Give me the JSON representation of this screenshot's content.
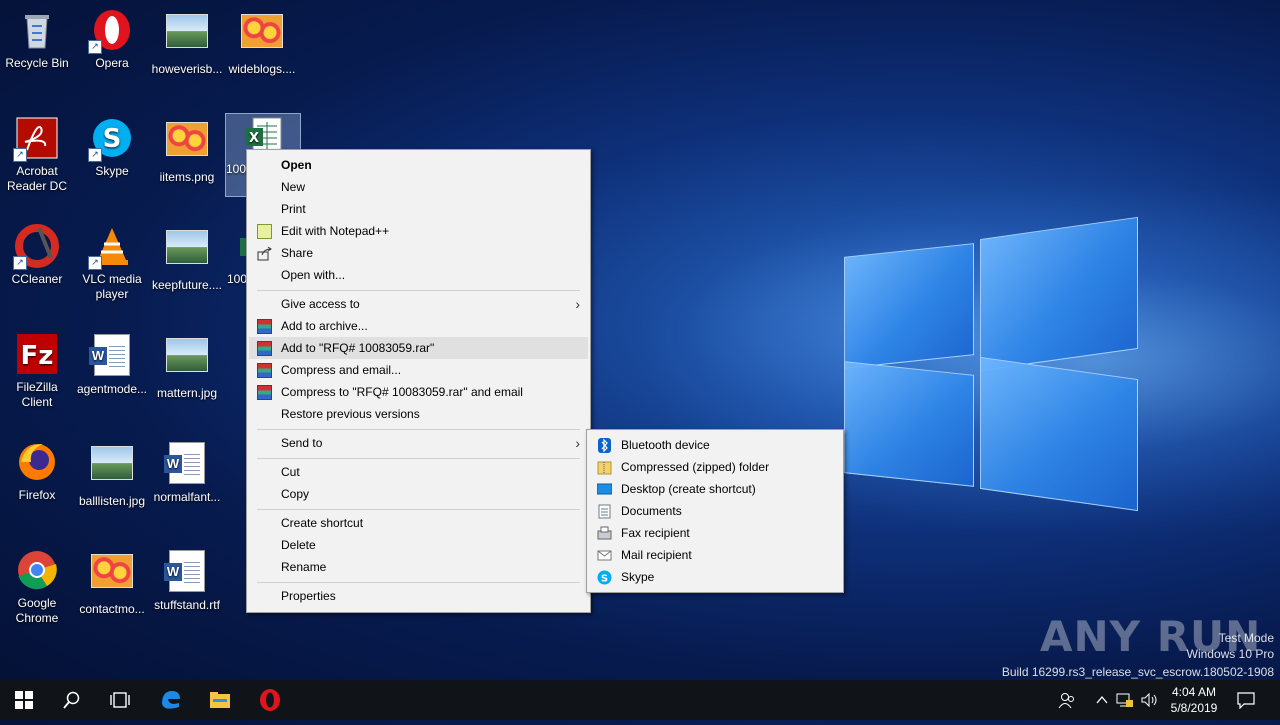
{
  "desktop": {
    "icons": [
      {
        "label": "Recycle Bin"
      },
      {
        "label": "Opera"
      },
      {
        "label": "howeverisb..."
      },
      {
        "label": "wideblogs...."
      },
      {
        "label": "Acrobat Reader DC"
      },
      {
        "label": "Skype"
      },
      {
        "label": "iitems.png"
      },
      {
        "label": "100"
      },
      {
        "label": "CCleaner"
      },
      {
        "label": "VLC media player"
      },
      {
        "label": "keepfuture...."
      },
      {
        "label": "100"
      },
      {
        "label": "FileZilla Client"
      },
      {
        "label": "agentmode..."
      },
      {
        "label": "mattern.jpg"
      },
      {
        "label": "Firefox"
      },
      {
        "label": "balllisten.jpg"
      },
      {
        "label": "normalfant..."
      },
      {
        "label": "Google Chrome"
      },
      {
        "label": "contactmo..."
      },
      {
        "label": "stuffstand.rtf"
      }
    ]
  },
  "context_menu": {
    "items": [
      {
        "label": "Open"
      },
      {
        "label": "New"
      },
      {
        "label": "Print"
      },
      {
        "label": "Edit with Notepad++"
      },
      {
        "label": "Share"
      },
      {
        "label": "Open with..."
      },
      {
        "label": "Give access to"
      },
      {
        "label": "Add to archive..."
      },
      {
        "label": "Add to \"RFQ# 10083059.rar\""
      },
      {
        "label": "Compress and email..."
      },
      {
        "label": "Compress to \"RFQ# 10083059.rar\" and email"
      },
      {
        "label": "Restore previous versions"
      },
      {
        "label": "Send to"
      },
      {
        "label": "Cut"
      },
      {
        "label": "Copy"
      },
      {
        "label": "Create shortcut"
      },
      {
        "label": "Delete"
      },
      {
        "label": "Rename"
      },
      {
        "label": "Properties"
      }
    ],
    "submenu_arrow": "›"
  },
  "send_to_menu": {
    "items": [
      {
        "label": "Bluetooth device",
        "icon": "bluetooth-icon"
      },
      {
        "label": "Compressed (zipped) folder",
        "icon": "zip-folder-icon"
      },
      {
        "label": "Desktop (create shortcut)",
        "icon": "desktop-icon"
      },
      {
        "label": "Documents",
        "icon": "documents-icon"
      },
      {
        "label": "Fax recipient",
        "icon": "fax-icon"
      },
      {
        "label": "Mail recipient",
        "icon": "mail-icon"
      },
      {
        "label": "Skype",
        "icon": "skype-icon"
      }
    ]
  },
  "watermark": {
    "brand": "ANY RUN",
    "mode": "Test Mode",
    "os": "Windows 10 Pro",
    "build": "Build 16299.rs3_release_svc_escrow.180502-1908"
  },
  "taskbar": {
    "time": "4:04 AM",
    "date": "5/8/2019"
  },
  "colors": {
    "accent": "#0078d7",
    "taskbar": "#101418",
    "menu_bg": "#f2f2f2"
  }
}
